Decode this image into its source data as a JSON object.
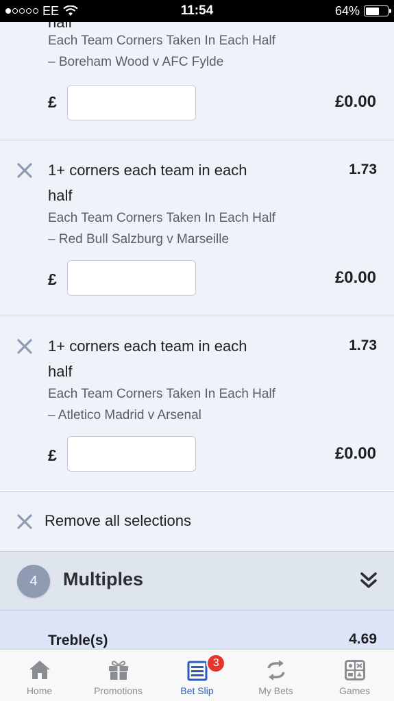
{
  "status_bar": {
    "carrier": "EE",
    "time": "11:54",
    "battery": "64%",
    "battery_level": 0.64
  },
  "selections": [
    {
      "title_partial": "half",
      "market": "Each Team Corners Taken In Each Half",
      "event": "– Boreham Wood v AFC Fylde",
      "currency": "£",
      "stake": "",
      "returns": "£0.00"
    },
    {
      "title": "1+ corners each team in each half",
      "odds": "1.73",
      "market": "Each Team Corners Taken In Each Half",
      "event": "– Red Bull Salzburg v Marseille",
      "currency": "£",
      "stake": "",
      "returns": "£0.00"
    },
    {
      "title": "1+ corners each team in each half",
      "odds": "1.73",
      "market": "Each Team Corners Taken In Each Half",
      "event": "– Atletico Madrid v Arsenal",
      "currency": "£",
      "stake": "",
      "returns": "£0.00"
    }
  ],
  "remove_all": {
    "label": "Remove all selections"
  },
  "multiples": {
    "count": "4",
    "title": "Multiples"
  },
  "treble": {
    "label": "Treble(s)",
    "odds": "4.69"
  },
  "tabs": [
    {
      "label": "Home",
      "icon": "home-icon"
    },
    {
      "label": "Promotions",
      "icon": "gift-icon"
    },
    {
      "label": "Bet Slip",
      "icon": "betslip-icon",
      "badge": "3",
      "active": true
    },
    {
      "label": "My Bets",
      "icon": "refresh-icon"
    },
    {
      "label": "Games",
      "icon": "games-icon"
    }
  ],
  "colors": {
    "accent": "#2a5bbd",
    "badge": "#e8352c",
    "remove_x": "#8e9bb3"
  }
}
